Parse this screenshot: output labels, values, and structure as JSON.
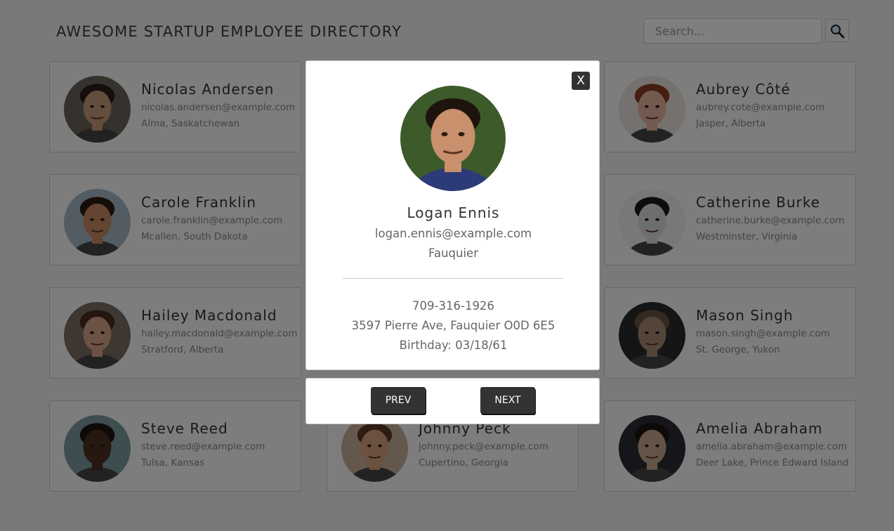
{
  "header": {
    "title": "AWESOME STARTUP EMPLOYEE DIRECTORY",
    "search_placeholder": "Search...",
    "search_icon": "magnifying-glass-icon"
  },
  "employees": [
    {
      "name": "Nicolas Andersen",
      "email": "nicolas.andersen@example.com",
      "location": "Alma, Saskatchewan",
      "skin": "#c79a7a",
      "hair": "#2b1d14",
      "bg": "#6b6258"
    },
    {
      "name": "Aubrey Côté",
      "email": "aubrey.cote@example.com",
      "location": "Jasper, Alberta",
      "skin": "#e4b49e",
      "hair": "#8a3b22",
      "bg": "#e8e2dc"
    },
    {
      "name": "Carole Franklin",
      "email": "carole.franklin@example.com",
      "location": "Mcallen, South Dakota",
      "skin": "#c98a62",
      "hair": "#2a1a10",
      "bg": "#a9b9c6"
    },
    {
      "name": "Catherine Burke",
      "email": "catherine.burke@example.com",
      "location": "Westminster, Virginia",
      "skin": "#dcdcdc",
      "hair": "#1b1b1b",
      "bg": "#f0f0f0"
    },
    {
      "name": "Hailey Macdonald",
      "email": "hailey.macdonald@example.com",
      "location": "Stratford, Alberta",
      "skin": "#d6a48a",
      "hair": "#4a2d1e",
      "bg": "#7a6d62"
    },
    {
      "name": "Mason Singh",
      "email": "mason.singh@example.com",
      "location": "St. George, Yukon",
      "skin": "#a88a72",
      "hair": "#6a5440",
      "bg": "#2a2a2a"
    },
    {
      "name": "Steve Reed",
      "email": "steve.reed@example.com",
      "location": "Tulsa, Kansas",
      "skin": "#4a3020",
      "hair": "#1a120c",
      "bg": "#7a9aa0"
    },
    {
      "name": "Johnny Peck",
      "email": "johnny.peck@example.com",
      "location": "Cupertino, Georgia",
      "skin": "#d9a080",
      "hair": "#5a3a22",
      "bg": "#c8b09a"
    },
    {
      "name": "Amelia Abraham",
      "email": "amelia.abraham@example.com",
      "location": "Deer Lake, Prince Edward Island",
      "skin": "#c8a890",
      "hair": "#1a1410",
      "bg": "#2c2c34"
    }
  ],
  "modal": {
    "close_label": "X",
    "name": "Logan Ennis",
    "email": "logan.ennis@example.com",
    "city": "Fauquier",
    "phone": "709-316-1926",
    "address": "3597 Pierre Ave, Fauquier O0D 6E5",
    "birthday": "Birthday: 03/18/61",
    "photo": {
      "skin": "#c8906c",
      "hair": "#1e140e",
      "bg": "#3d5a2a",
      "shirt": "#2c3a7a"
    }
  },
  "nav": {
    "prev_label": "PREV",
    "next_label": "NEXT"
  }
}
